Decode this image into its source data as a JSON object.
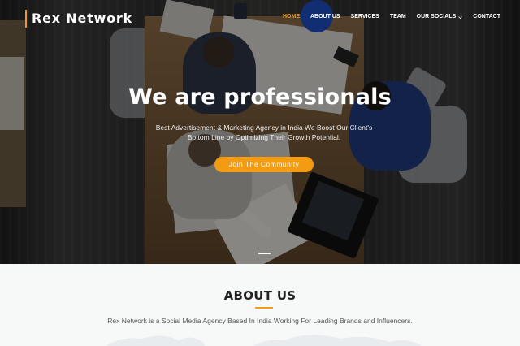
{
  "header": {
    "logo": "Rex Network",
    "nav": [
      {
        "label": "HOME",
        "active": true
      },
      {
        "label": "ABOUT US"
      },
      {
        "label": "SERVICES"
      },
      {
        "label": "TEAM"
      },
      {
        "label": "OUR SOCIALS",
        "dropdown": true
      },
      {
        "label": "CONTACT"
      }
    ]
  },
  "hero": {
    "title": "We are professionals",
    "subtitle": "Best Advertisement & Marketing Agency in India We Boost Our Client's Bottom Line by Optimizing Their Growth Potential.",
    "cta_label": "Join The Community"
  },
  "about": {
    "title": "ABOUT US",
    "text": "Rex Network is a Social Media Agency Based In India Working For Leading Brands and Influencers."
  },
  "colors": {
    "accent": "#f39c12",
    "hero_text": "#ffffff",
    "about_bg": "#f7f8f8"
  },
  "icons": {
    "dropdown": "chevron-down-icon"
  }
}
